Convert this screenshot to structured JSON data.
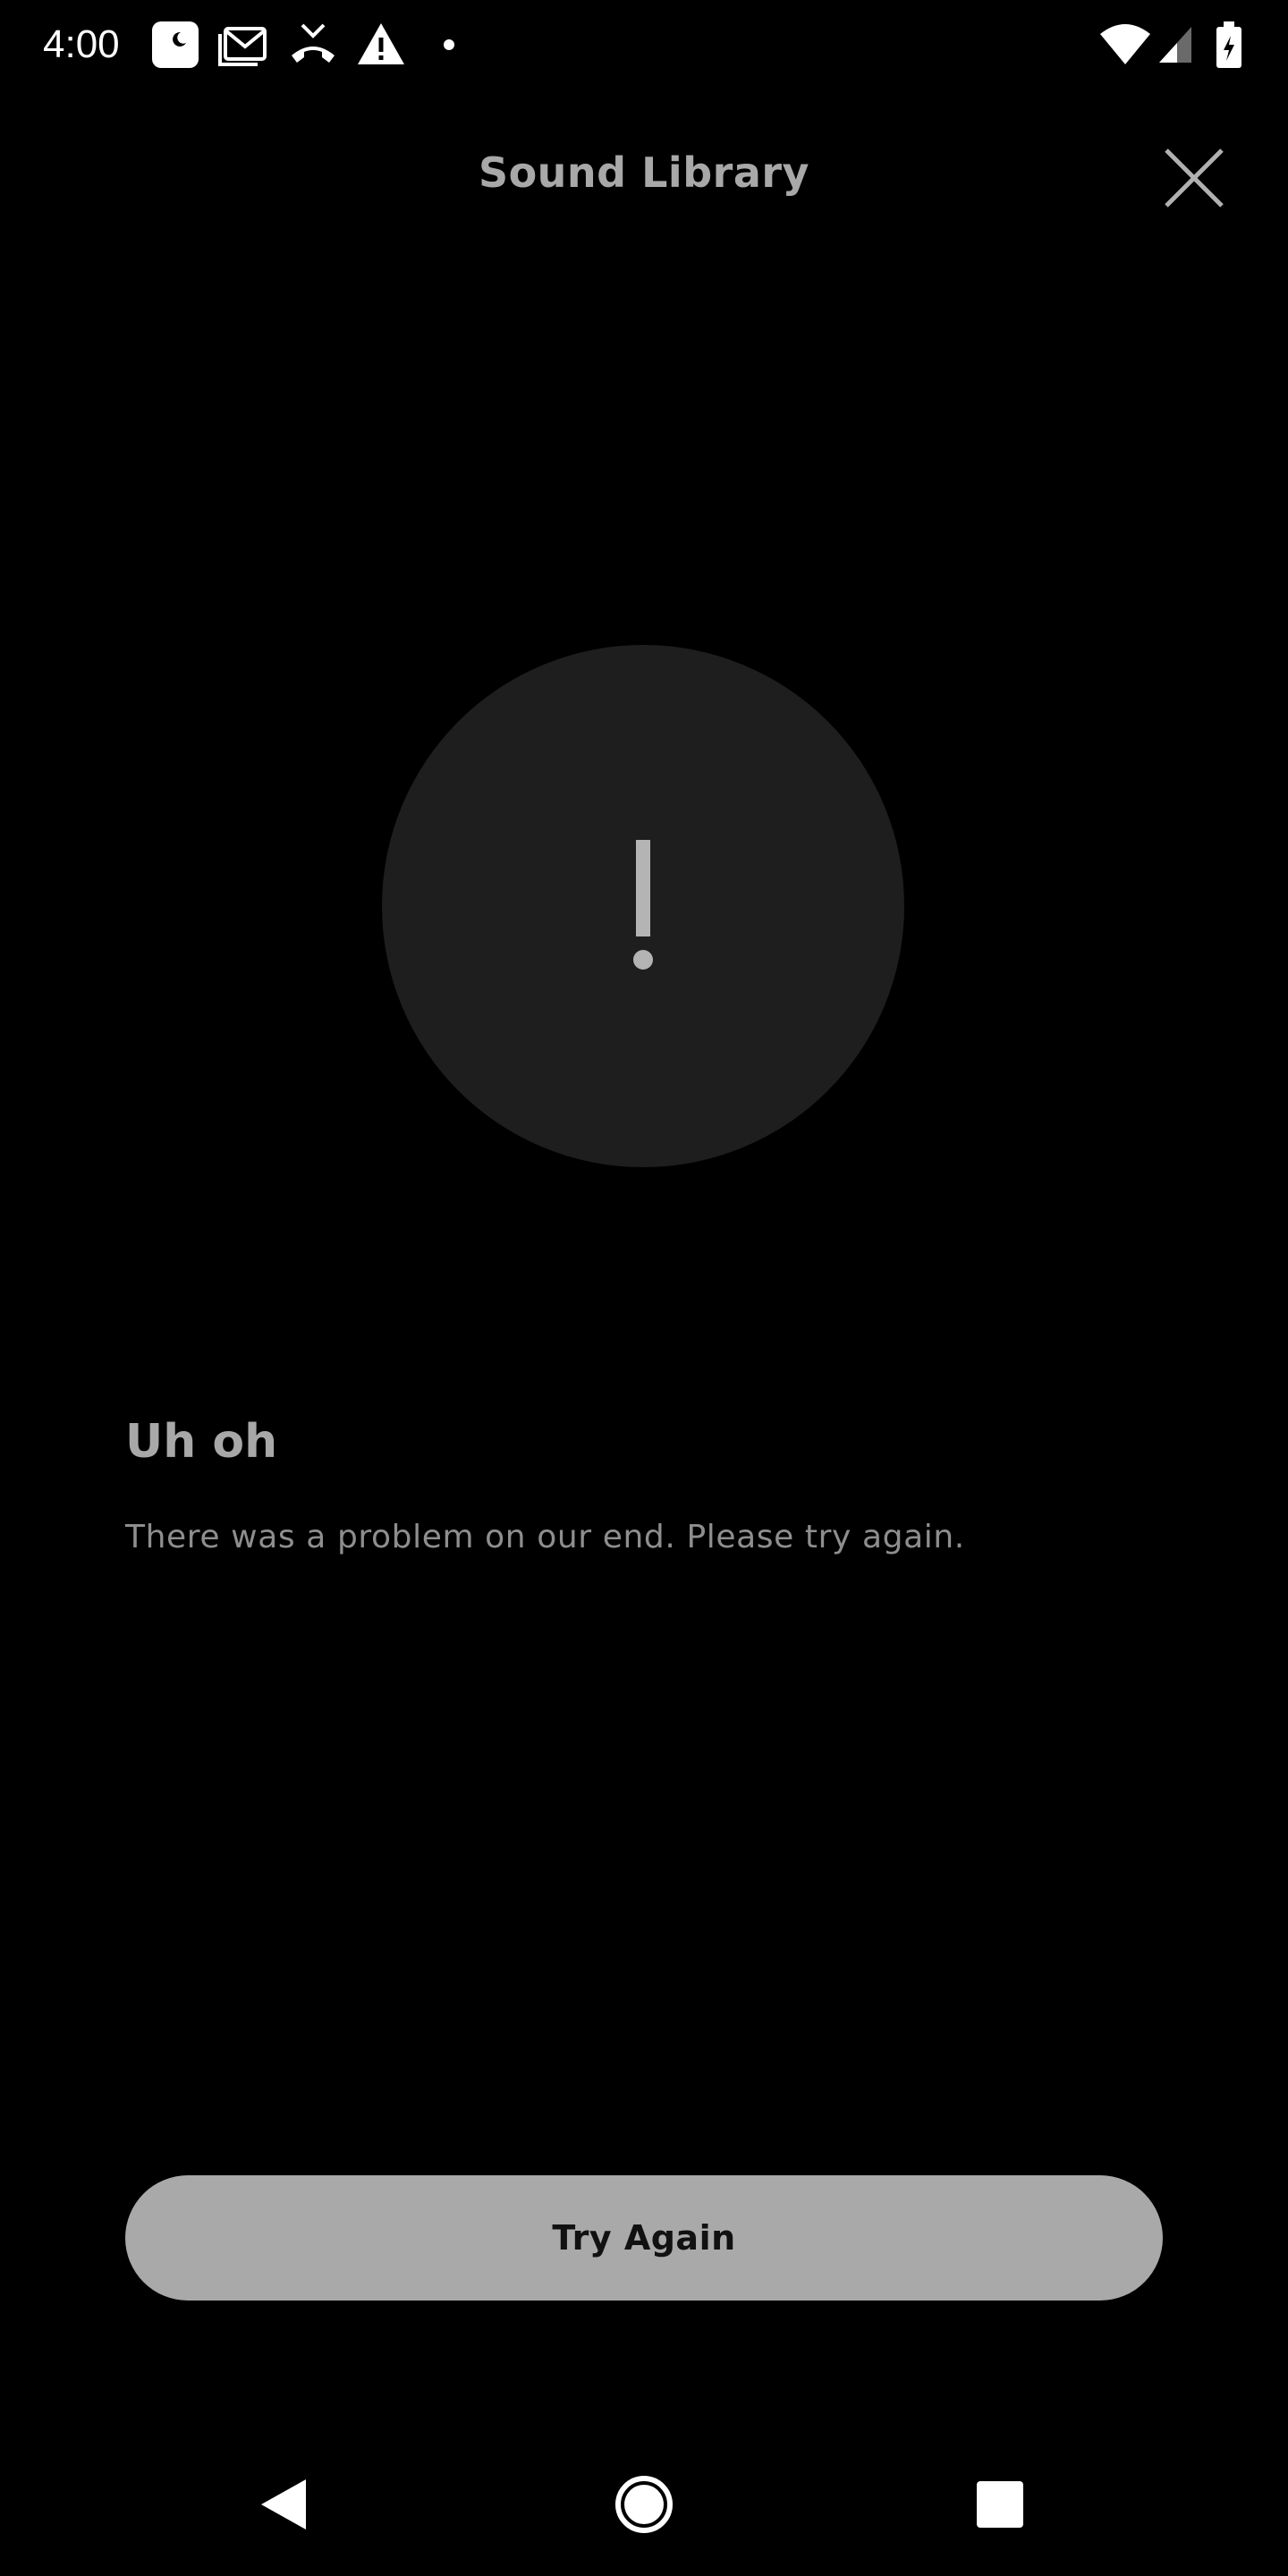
{
  "status_bar": {
    "time": "4:00",
    "notification_icons": [
      "moon-app-icon",
      "gmail-icon",
      "missed-call-icon",
      "warning-icon",
      "dot-icon"
    ],
    "system_icons": [
      "wifi-icon",
      "cell-signal-icon",
      "battery-charging-icon"
    ]
  },
  "header": {
    "title": "Sound Library",
    "close_icon": "close-icon"
  },
  "error": {
    "icon": "exclamation-icon",
    "title": "Uh oh",
    "message": "There was a problem on our end. Please try again."
  },
  "actions": {
    "try_again_label": "Try Again"
  },
  "nav_bar": {
    "buttons": [
      "back-icon",
      "home-icon",
      "recents-icon"
    ]
  },
  "colors": {
    "background": "#000000",
    "circle": "#1e1e1e",
    "accent_gray": "#a8a8a8",
    "button": "#a9a9a9"
  }
}
